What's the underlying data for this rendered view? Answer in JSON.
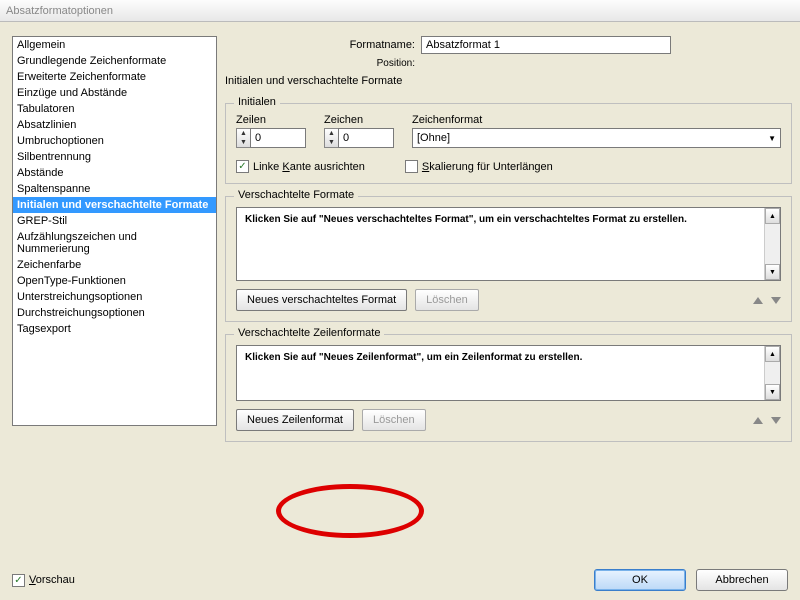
{
  "window": {
    "title": "Absatzformatoptionen"
  },
  "sidebar": {
    "items": [
      "Allgemein",
      "Grundlegende Zeichenformate",
      "Erweiterte Zeichenformate",
      "Einzüge und Abstände",
      "Tabulatoren",
      "Absatzlinien",
      "Umbruchoptionen",
      "Silbentrennung",
      "Abstände",
      "Spaltenspanne",
      "Initialen und verschachtelte Formate",
      "GREP-Stil",
      "Aufzählungszeichen und Nummerierung",
      "Zeichenfarbe",
      "OpenType-Funktionen",
      "Unterstreichungsoptionen",
      "Durchstreichungsoptionen",
      "Tagsexport"
    ],
    "selected_index": 10
  },
  "header": {
    "name_label": "Formatname:",
    "name_value": "Absatzformat 1",
    "position_label": "Position:",
    "section": "Initialen und verschachtelte Formate"
  },
  "initials": {
    "group_title": "Initialen",
    "lines_label": "Zeilen",
    "lines_value": "0",
    "chars_label": "Zeichen",
    "chars_value": "0",
    "charstyle_label": "Zeichenformat",
    "charstyle_value": "[Ohne]",
    "align_left_label_pre": "Linke ",
    "align_left_label_u": "K",
    "align_left_label_post": "ante ausrichten",
    "align_left_checked": true,
    "scale_label_pre": "",
    "scale_label_u": "S",
    "scale_label_post": "kalierung für Unterlängen",
    "scale_checked": false
  },
  "nested_styles": {
    "group_title": "Verschachtelte Formate",
    "hint": "Klicken Sie auf \"Neues verschachteltes Format\", um ein verschachteltes Format zu erstellen.",
    "new_btn": "Neues verschachteltes Format",
    "delete_btn": "Löschen"
  },
  "nested_lines": {
    "group_title": "Verschachtelte Zeilenformate",
    "hint": "Klicken Sie auf \"Neues Zeilenformat\", um ein Zeilenformat zu erstellen.",
    "new_btn": "Neues Zeilenformat",
    "delete_btn": "Löschen"
  },
  "footer": {
    "preview_label_u": "V",
    "preview_label_post": "orschau",
    "preview_checked": true,
    "ok": "OK",
    "cancel": "Abbrechen"
  }
}
